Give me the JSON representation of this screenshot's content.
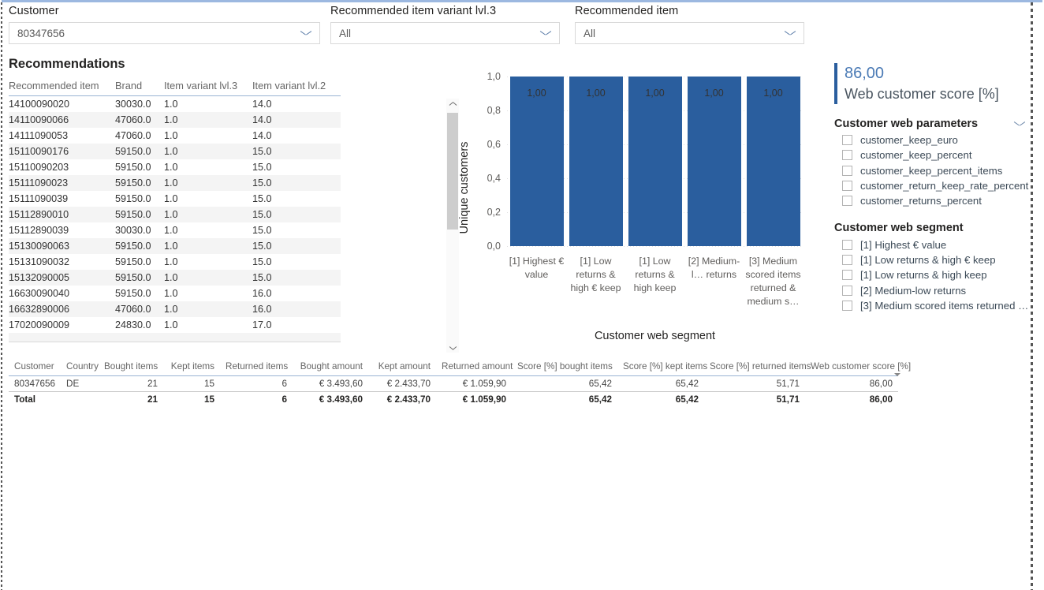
{
  "slicers": [
    {
      "label": "Customer",
      "value": "80347656",
      "icon": "chevron-down-icon"
    },
    {
      "label": "Recommended item variant lvl.3",
      "value": "All",
      "icon": "chevron-down-icon"
    },
    {
      "label": "Recommended item",
      "value": "All",
      "icon": "chevron-down-icon"
    }
  ],
  "recommendations": {
    "title": "Recommendations",
    "columns": [
      "Recommended item",
      "Brand",
      "Item variant lvl.3",
      "Item variant lvl.2"
    ],
    "rows": [
      [
        "14100090020",
        "30030.0",
        "1.0",
        "14.0"
      ],
      [
        "14110090066",
        "47060.0",
        "1.0",
        "14.0"
      ],
      [
        "14111090053",
        "47060.0",
        "1.0",
        "14.0"
      ],
      [
        "15110090176",
        "59150.0",
        "1.0",
        "15.0"
      ],
      [
        "15110090203",
        "59150.0",
        "1.0",
        "15.0"
      ],
      [
        "15111090023",
        "59150.0",
        "1.0",
        "15.0"
      ],
      [
        "15111090039",
        "59150.0",
        "1.0",
        "15.0"
      ],
      [
        "15112890010",
        "59150.0",
        "1.0",
        "15.0"
      ],
      [
        "15112890039",
        "30030.0",
        "1.0",
        "15.0"
      ],
      [
        "15130090063",
        "59150.0",
        "1.0",
        "15.0"
      ],
      [
        "15131090032",
        "59150.0",
        "1.0",
        "15.0"
      ],
      [
        "15132090005",
        "59150.0",
        "1.0",
        "15.0"
      ],
      [
        "16630090040",
        "59150.0",
        "1.0",
        "16.0"
      ],
      [
        "16632890006",
        "47060.0",
        "1.0",
        "16.0"
      ],
      [
        "17020090009",
        "24830.0",
        "1.0",
        "17.0"
      ]
    ]
  },
  "chart_data": {
    "type": "bar",
    "title": "",
    "xlabel": "Customer web segment",
    "ylabel": "Unique customers",
    "ylim": [
      0,
      1
    ],
    "grid": true,
    "legend": null,
    "categories": [
      "[1] Highest € value",
      "[1] Low returns & high € keep",
      "[1] Low returns & high keep",
      "[2] Medium-l… returns",
      "[3] Medium scored items returned & medium s…"
    ],
    "values": [
      1.0,
      1.0,
      1.0,
      1.0,
      1.0
    ],
    "data_labels": [
      "1,00",
      "1,00",
      "1,00",
      "1,00",
      "1,00"
    ],
    "yticks": [
      "1,0",
      "0,8",
      "0,6",
      "0,4",
      "0,2",
      "0,0"
    ],
    "ytick_values": [
      1.0,
      0.8,
      0.6,
      0.4,
      0.2,
      0.0
    ],
    "bar_color": "#2a5e9e"
  },
  "card": {
    "value": "86,00",
    "caption": "Web customer score [%]",
    "accent_color": "#2a5e9e"
  },
  "parameters_group": {
    "title": "Customer web parameters",
    "icon": "chevron-down-icon",
    "items": [
      "customer_keep_euro",
      "customer_keep_percent",
      "customer_keep_percent_items",
      "customer_return_keep_rate_percent",
      "customer_returns_percent"
    ]
  },
  "segment_group": {
    "title": "Customer web segment",
    "items": [
      "[1] Highest € value",
      "[1] Low returns & high € keep",
      "[1] Low returns & high keep",
      "[2] Medium-low returns",
      "[3] Medium scored items returned …"
    ]
  },
  "summary": {
    "columns": [
      "Customer",
      "Country",
      "Bought items",
      "Kept items",
      "Returned items",
      "Bought amount",
      "Kept amount",
      "Returned amount",
      "Score [%] bought items",
      "Score [%] kept items",
      "Score [%] returned items",
      "Web customer score [%]"
    ],
    "sorted_column": "Web customer score [%]",
    "rows": [
      [
        "80347656",
        "DE",
        "21",
        "15",
        "6",
        "€ 3.493,60",
        "€ 2.433,70",
        "€ 1.059,90",
        "65,42",
        "65,42",
        "51,71",
        "86,00"
      ]
    ],
    "total": [
      "Total",
      "",
      "21",
      "15",
      "6",
      "€ 3.493,60",
      "€ 2.433,70",
      "€ 1.059,90",
      "65,42",
      "65,42",
      "51,71",
      "86,00"
    ]
  }
}
